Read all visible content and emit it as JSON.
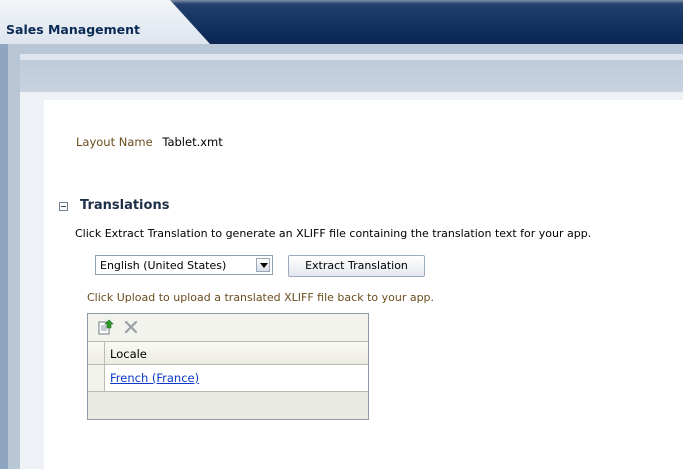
{
  "app": {
    "tab_title": "Sales Management"
  },
  "layout": {
    "label": "Layout Name",
    "value": "Tablet.xmt"
  },
  "translations": {
    "title": "Translations",
    "extract_instruction": "Click Extract Translation to generate an XLIFF file containing the translation text for your app.",
    "language_select": {
      "selected": "English (United States)"
    },
    "extract_button": "Extract Translation",
    "upload_instruction": "Click Upload to upload a translated XLIFF file back to your app.",
    "table": {
      "toolbar": {
        "upload_icon": "upload-icon",
        "delete_icon": "delete-icon"
      },
      "columns": [
        "Locale"
      ],
      "rows": [
        {
          "locale": "French (France)"
        }
      ]
    }
  },
  "colors": {
    "tab_bar": "#0f2e5c",
    "label_brown": "#6b4d1e",
    "link_blue": "#0b39c9"
  }
}
